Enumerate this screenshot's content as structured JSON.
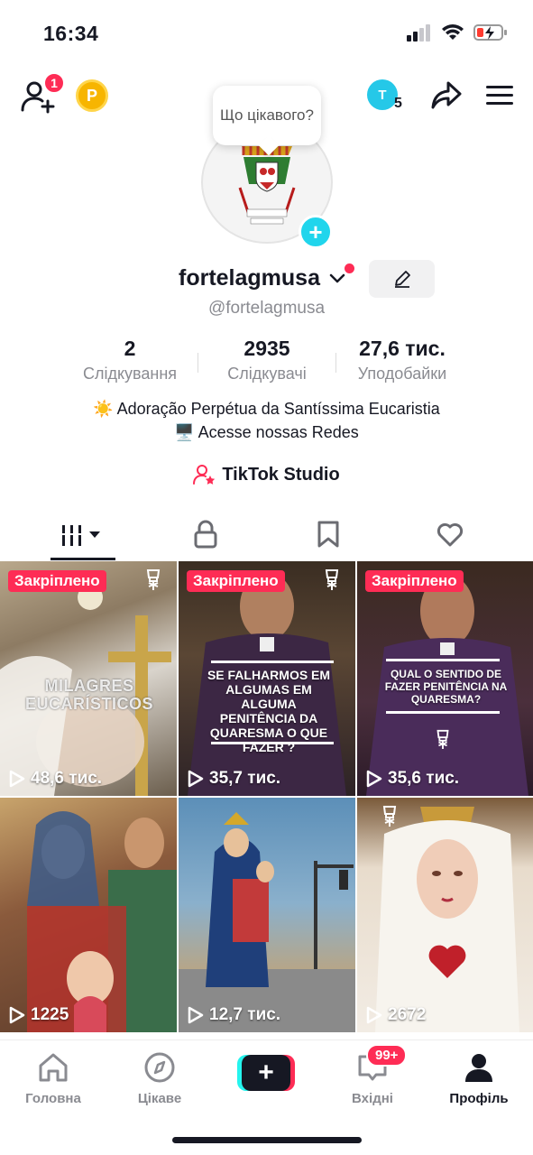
{
  "status_bar": {
    "time": "16:34"
  },
  "top_bar": {
    "add_friend_badge": "1",
    "coin_letter": "P",
    "tcoin_letter": "T",
    "tcoin_count": "5"
  },
  "profile": {
    "bubble_text": "Що цікавого?",
    "display_name": "fortelagmusa",
    "handle": "@fortelagmusa",
    "stats": [
      {
        "value": "2",
        "label": "Слідкування"
      },
      {
        "value": "2935",
        "label": "Слідкувачі"
      },
      {
        "value": "27,6 тис.",
        "label": "Уподобайки"
      }
    ],
    "bio_lines": [
      "☀️ Adoração Perpétua da Santíssima Eucaristia",
      "🖥️ Acesse nossas Redes"
    ],
    "studio_label": "TikTok Studio"
  },
  "tabs": [
    {
      "icon": "videos-grid-icon",
      "active": true
    },
    {
      "icon": "lock-icon",
      "active": false
    },
    {
      "icon": "bookmark-icon",
      "active": false
    },
    {
      "icon": "heart-icon",
      "active": false
    }
  ],
  "videos": [
    {
      "pinned": true,
      "pin_label": "Закріплено",
      "views": "48,6 тис.",
      "overlay": "MILAGRES EUCARÍSTICOS"
    },
    {
      "pinned": true,
      "pin_label": "Закріплено",
      "views": "35,7 тис.",
      "overlay": "SE FALHARMOS EM ALGUMAS EM ALGUMA PENITÊNCIA DA QUARESMA O QUE FAZER ?"
    },
    {
      "pinned": true,
      "pin_label": "Закріплено",
      "views": "35,6 тис.",
      "overlay": "QUAL O SENTIDO DE FAZER PENITÊNCIA NA QUARESMA?"
    },
    {
      "pinned": false,
      "views": "1225"
    },
    {
      "pinned": false,
      "views": "12,7 тис."
    },
    {
      "pinned": false,
      "views": "2672"
    }
  ],
  "bottom_nav": {
    "home": "Головна",
    "discover": "Цікаве",
    "inbox": "Вхідні",
    "inbox_badge": "99+",
    "profile": "Профіль"
  },
  "colors": {
    "accent": "#fe2c55",
    "cyan": "#25f4ee",
    "text": "#161823",
    "muted": "#8a8b91"
  }
}
